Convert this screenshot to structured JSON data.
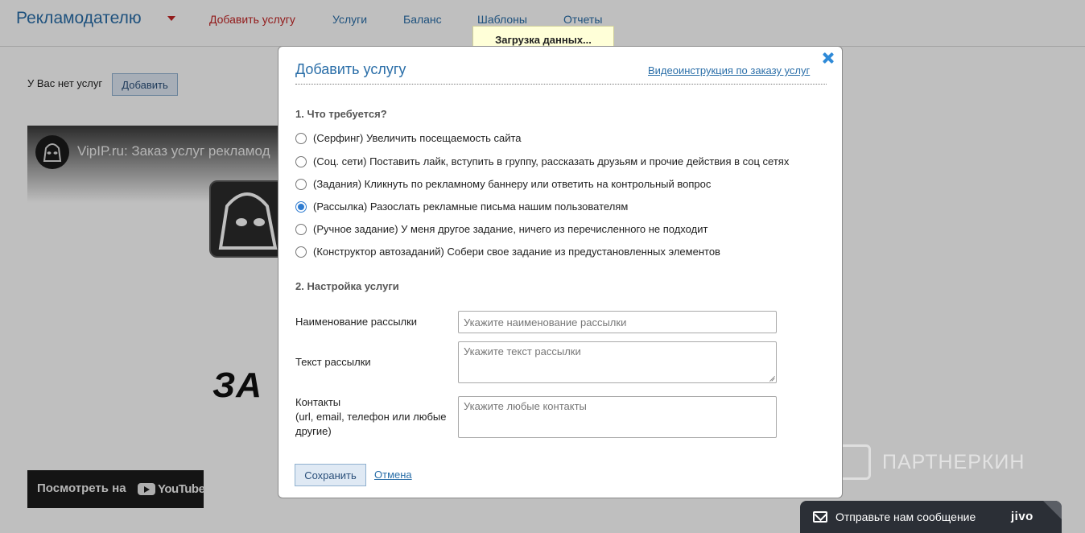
{
  "header": {
    "brand": "Рекламодателю",
    "nav": [
      "Добавить услугу",
      "Услуги",
      "Баланс",
      "Шаблоны",
      "Отчеты"
    ],
    "active_color": "#c32525",
    "link_color": "#2a6ea8"
  },
  "page": {
    "empty_text": "У Вас нет услуг",
    "add_button": "Добавить"
  },
  "video": {
    "title": "VipIP.ru: Заказ услуг рекламод",
    "big_text": "ЗА",
    "watch_on": "Посмотреть на",
    "youtube": "YouTube"
  },
  "loading": "Загрузка данных...",
  "modal": {
    "title": "Добавить услугу",
    "video_link": "Видеоинструкция по заказу услуг",
    "section1": "1. Что требуется?",
    "options": [
      "(Серфинг) Увеличить посещаемость сайта",
      "(Соц. сети) Поставить лайк, вступить в группу, рассказать друзьям и прочие действия в соц сетях",
      "(Задания) Кликнуть по рекламному баннеру или ответить на контрольный вопрос",
      "(Рассылка) Разослать рекламные письма нашим пользователям",
      "(Ручное задание) У меня другое задание, ничего из перечисленного не подходит",
      "(Конструктор автозаданий) Собери свое задание из предустановленных элементов"
    ],
    "selected_option": 3,
    "section2": "2. Настройка услуги",
    "fields": {
      "name_label": "Наименование рассылки",
      "name_placeholder": "Укажите наименование рассылки",
      "text_label": "Текст рассылки",
      "text_placeholder": "Укажите текст рассылки",
      "contacts_label": "Контакты",
      "contacts_sub": "(url, email, телефон или любые другие)",
      "contacts_placeholder": "Укажите любые контакты"
    },
    "save": "Сохранить",
    "cancel": "Отмена"
  },
  "watermark": "ПАРТНЕРКИН",
  "jivo": {
    "message": "Отправьте нам сообщение",
    "brand": "jivo"
  }
}
